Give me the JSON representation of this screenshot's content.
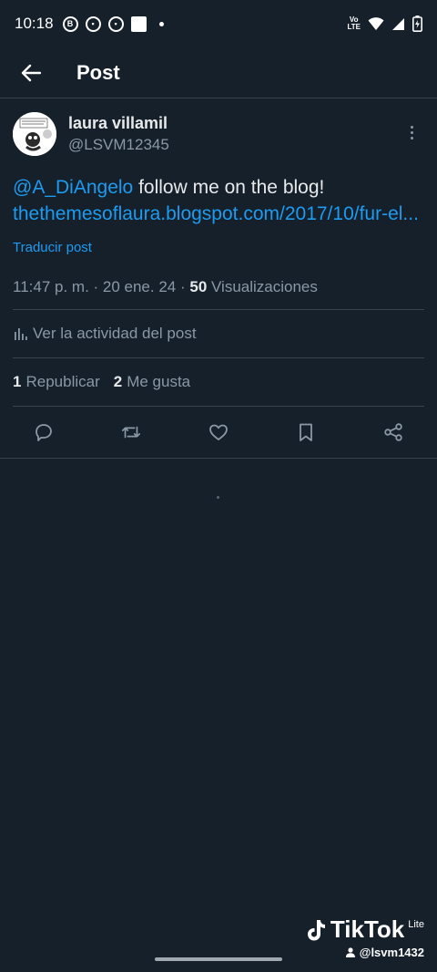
{
  "status_bar": {
    "time": "10:18",
    "network_label_top": "Vo",
    "network_label_bottom": "LTE"
  },
  "header": {
    "title": "Post",
    "back_icon": "arrow-left-icon"
  },
  "post": {
    "author_name": "laura villamil",
    "author_handle": "@LSVM12345",
    "mention": "@A_DiAngelo",
    "text_after_mention": " follow me on the blog!",
    "link": "thethemesoflaura.blogspot.com/2017/10/fur-el...",
    "translate": "Traducir post",
    "timestamp": "11:47 p. m. · 20 ene. 24 · ",
    "views_count": "50",
    "views_label": " Visualizaciones",
    "activity_label": "Ver la actividad del post",
    "reposts_count": "1",
    "reposts_label": "Republicar",
    "likes_count": "2",
    "likes_label": "Me gusta"
  },
  "actions": [
    "reply-icon",
    "repost-icon",
    "like-icon",
    "bookmark-icon",
    "share-icon"
  ],
  "watermark": {
    "brand": "TikTok",
    "variant": "Lite",
    "user": "@lsvm1432"
  },
  "colors": {
    "background": "#15202b",
    "accent": "#1d9bf0",
    "secondary_text": "#8b98a5",
    "divider": "#38444d"
  }
}
